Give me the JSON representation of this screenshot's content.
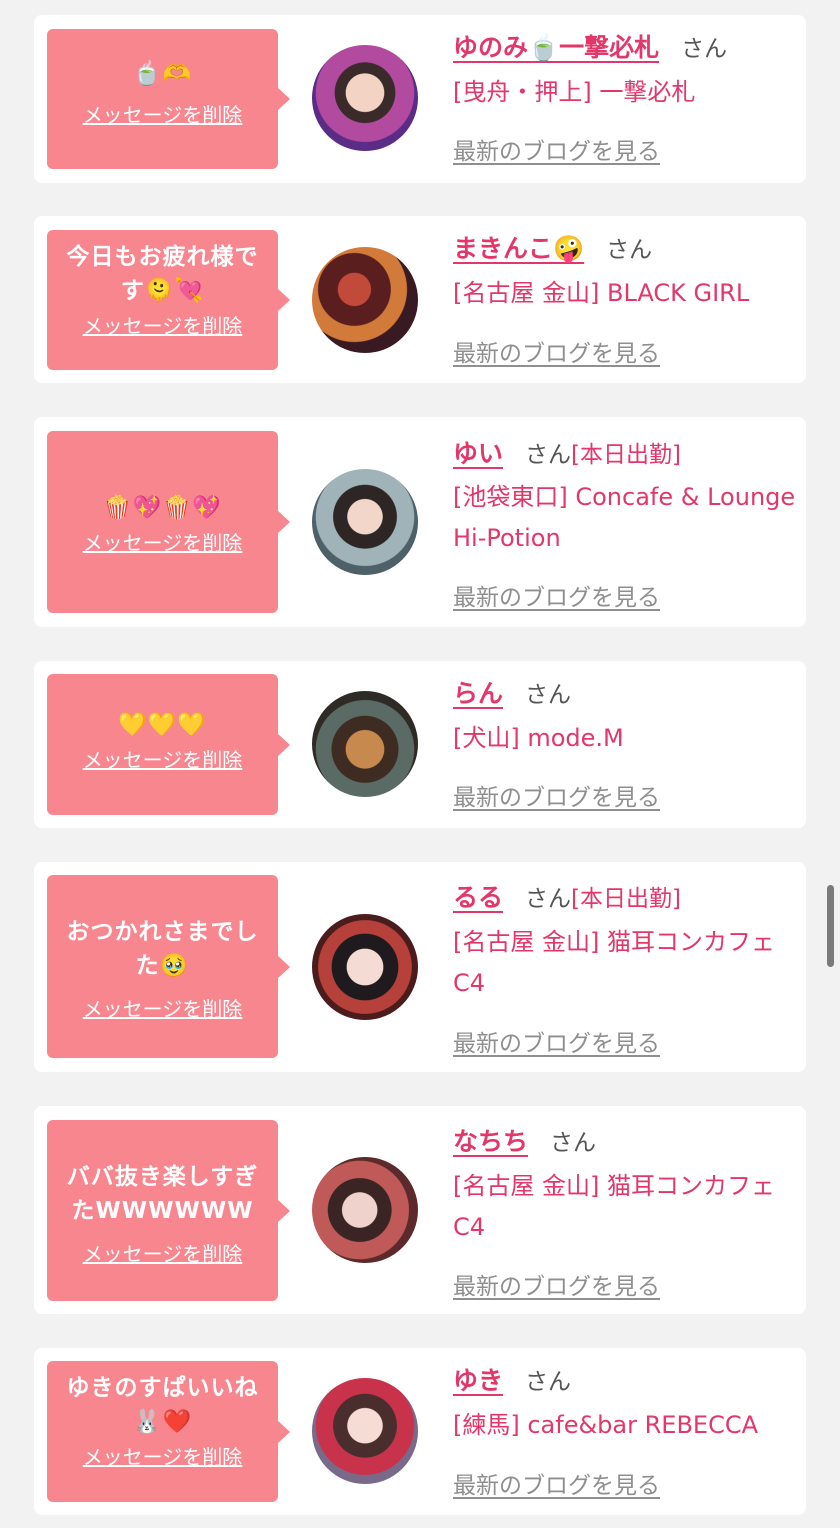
{
  "delete_label": "メッセージを削除",
  "san_label": "さん",
  "blog_label": "最新のブログを見る",
  "colors": {
    "page_background": "#f2f2f2",
    "card_background": "#ffffff",
    "bubble_pink": "#f7868f",
    "name_pink": "#e3376a",
    "link_gray": "#8f8f8f"
  },
  "entries": [
    {
      "message": "🍵🫶",
      "name": "ゆのみ🍵一撃必札",
      "today": "",
      "shop": "[曳舟・押上] 一撃必札"
    },
    {
      "message": "今日もお疲れ様です🫠💘",
      "name": "まきんこ🤪",
      "today": "",
      "shop": "[名古屋 金山] BLACK GIRL"
    },
    {
      "message": "🍿💖🍿💖",
      "name": "ゆい",
      "today": "[本日出勤]",
      "shop": "[池袋東口] Concafe & Lounge Hi-Potion"
    },
    {
      "message": "💛💛💛",
      "name": "らん",
      "today": "",
      "shop": "[犬山] mode.M"
    },
    {
      "message": "おつかれさまでした🥹",
      "name": "るる",
      "today": "[本日出勤]",
      "shop": "[名古屋 金山] 猫耳コンカフェ C4"
    },
    {
      "message": "ババ抜き楽しすぎたWWWWWW",
      "name": "なちち",
      "today": "",
      "shop": "[名古屋 金山] 猫耳コンカフェ C4"
    },
    {
      "message": "ゆきのすぱいいね🐰❤️",
      "name": "ゆき",
      "today": "",
      "shop": "[練馬] cafe&bar REBECCA"
    }
  ]
}
